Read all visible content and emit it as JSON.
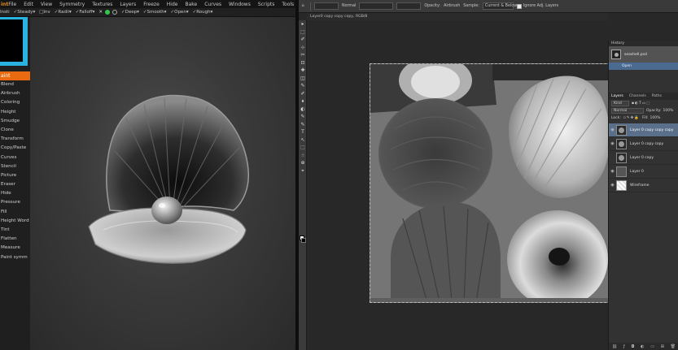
{
  "zbrush": {
    "app_name": "int",
    "menus": [
      "File",
      "Edit",
      "View",
      "Symmetry",
      "Textures",
      "Layers",
      "Freeze",
      "Hide",
      "Bake",
      "Curves",
      "Windows",
      "Scripts",
      "Tools"
    ],
    "toolbar": [
      "Insti",
      "Steady",
      "Inv",
      "Radii",
      "Falloff",
      "Deep",
      "Smooth",
      "Open",
      "Rough"
    ],
    "active_brush": "aint",
    "brushes": [
      "Blend",
      "Airbrush",
      "Coloring",
      "Height",
      "Smudge",
      "Clone",
      "Transform",
      "Copy/Paste",
      "Curves",
      "Stencil",
      "Picture",
      "Eraser",
      "Hide",
      "Pressure",
      "Fill",
      "Height  Word",
      "Tint",
      "Flatten",
      "Measure",
      "Paint symm"
    ]
  },
  "photoshop": {
    "options": {
      "mode_label": "Normal",
      "brush_size": "",
      "opacity_label": "Opacity:",
      "airbrush_label": "Airbrush",
      "sample_label": "Sample:",
      "sample_value": "Current & Below",
      "ignore_label": "Ignore Adj. Layers"
    },
    "doc_tab": "Layer0 copy copy copy, RGB/8",
    "tools": [
      "▸",
      "⬚",
      "✐",
      "⊹",
      "✂",
      "⊡",
      "✚",
      "◫",
      "✎",
      "✐",
      "⬧",
      "◐",
      "✎",
      "✎",
      "T",
      "↖",
      "⬚",
      "☝",
      "⊕",
      "⌖",
      "◌",
      "▭",
      "▢"
    ],
    "history": {
      "title": "History",
      "snapshot_label": "seashell.psd",
      "open_step": "Open"
    },
    "layers_panel": {
      "tabs": [
        "Layers",
        "Channels",
        "Paths"
      ],
      "kind_label": "Kind",
      "blend_mode": "Normal",
      "opacity_label": "Opacity:",
      "opacity_value": "100%",
      "lock_label": "Lock:",
      "fill_label": "Fill:",
      "fill_value": "100%",
      "layers": [
        {
          "name": "Layer 0 copy copy copy",
          "selected": true
        },
        {
          "name": "Layer 0 copy copy",
          "selected": false
        },
        {
          "name": "Layer 0 copy",
          "selected": false
        },
        {
          "name": "Layer 0",
          "selected": false
        },
        {
          "name": "Wireframe",
          "selected": false
        }
      ],
      "footer_icons": [
        "link-icon",
        "fx-icon",
        "mask-icon",
        "adjustment-icon",
        "group-icon",
        "new-layer-icon",
        "trash-icon"
      ]
    }
  },
  "colors": {
    "accent_orange": "#ea6a12",
    "preview_cyan": "#2ab3e0",
    "selection_blue": "#596f8a"
  }
}
